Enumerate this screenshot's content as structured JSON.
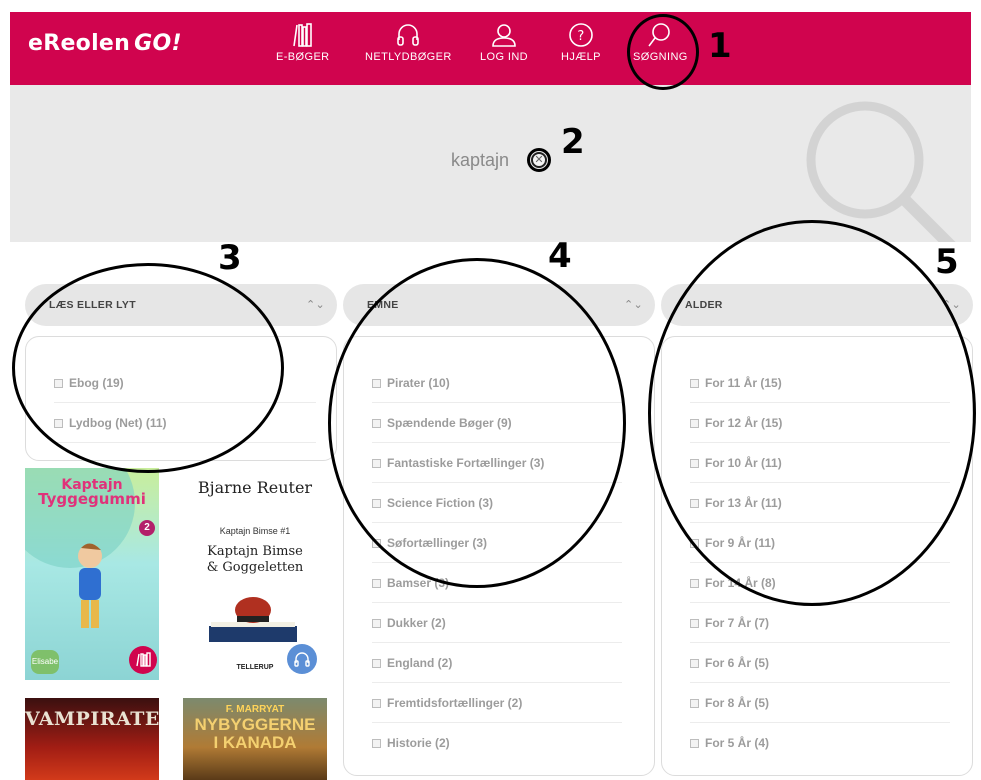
{
  "header": {
    "logo": "eReolen",
    "logo_go": "GO!",
    "nav": [
      {
        "label": "E-BØGER",
        "icon": "books-icon"
      },
      {
        "label": "NETLYDBØGER",
        "icon": "headphones-icon"
      },
      {
        "label": "LOG IND",
        "icon": "user-icon"
      },
      {
        "label": "HJÆLP",
        "icon": "help-icon"
      },
      {
        "label": "SØGNING",
        "icon": "search-icon"
      }
    ]
  },
  "search": {
    "query": "kaptajn",
    "clear_symbol": "✕"
  },
  "annotations": [
    "1",
    "2",
    "3",
    "4",
    "5"
  ],
  "filters": [
    {
      "title": "LÆS ELLER LYT",
      "options": [
        "Ebog (19)",
        "Lydbog (Net) (11)"
      ]
    },
    {
      "title": "EMNE",
      "options": [
        "Pirater (10)",
        "Spændende Bøger (9)",
        "Fantastiske Fortællinger (3)",
        "Science Fiction (3)",
        "Søfortællinger (3)",
        "Bamser (3)",
        "Dukker (2)",
        "England (2)",
        "Fremtidsfortællinger (2)",
        "Historie (2)"
      ]
    },
    {
      "title": "ALDER",
      "options": [
        "For 11 År (15)",
        "For 12 År (15)",
        "For 10 År (11)",
        "For 13 År (11)",
        "For 9 År (11)",
        "For 14 År (8)",
        "For 7 År (7)",
        "For 6 År (5)",
        "For 8 År (5)",
        "For 5 År (4)"
      ]
    }
  ],
  "books": [
    {
      "title_line1": "Kaptajn",
      "title_line2": "Tyggegummi",
      "series_number": "2",
      "publisher": "Elisabe"
    },
    {
      "author": "Bjarne Reuter",
      "series": "Kaptajn Bimse #1",
      "title_line1": "Kaptajn Bimse",
      "title_line2": "& Goggeletten",
      "publisher": "TELLERUP"
    },
    {
      "title": "VAMPIRATER"
    },
    {
      "author": "F. MARRYAT",
      "title_line1": "NYBYGGERNE",
      "title_line2": "I KANADA"
    }
  ],
  "colors": {
    "brand": "#d0044e",
    "search_band": "#e9e9e9",
    "filter_head": "#e6e6e6",
    "option_text": "#9c9c9c"
  }
}
